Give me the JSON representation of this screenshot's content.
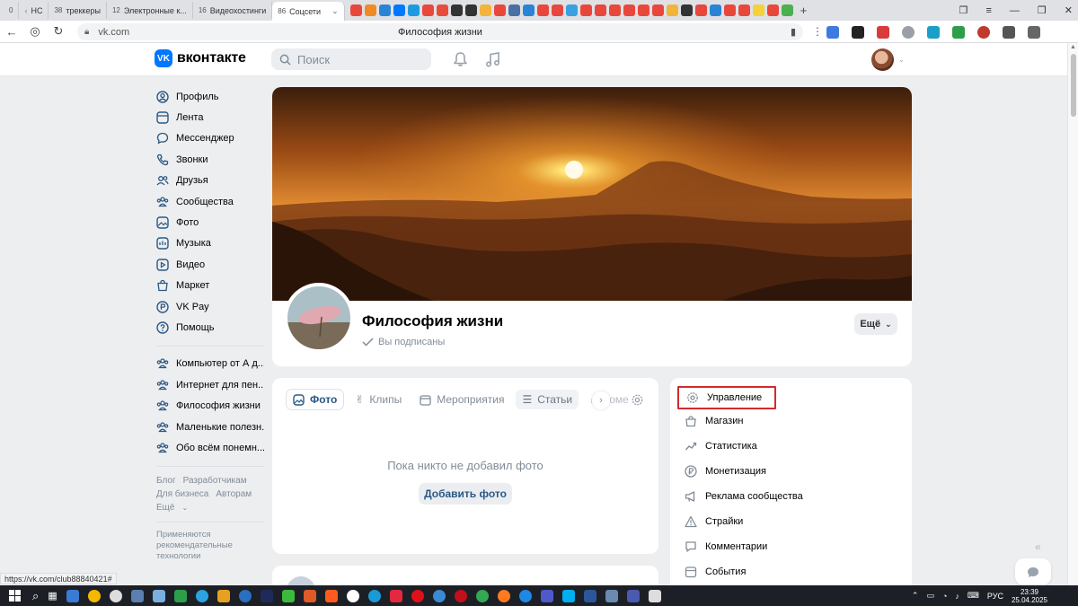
{
  "browser": {
    "tabs": [
      {
        "count": "0",
        "label": ""
      },
      {
        "count": "",
        "label": "НС"
      },
      {
        "count": "38",
        "label": "треккеры"
      },
      {
        "count": "12",
        "label": "Электронные к..."
      },
      {
        "count": "16",
        "label": "Видеохостинги"
      },
      {
        "count": "86",
        "label": "Соцсети"
      }
    ],
    "url": "vk.com",
    "page_title": "Философия жизни",
    "status_link": "https://vk.com/club88840421#"
  },
  "header": {
    "logo": "вконтакте",
    "search_placeholder": "Поиск"
  },
  "leftnav": {
    "main": [
      {
        "label": "Профиль",
        "icon": "user-icon"
      },
      {
        "label": "Лента",
        "icon": "feed-icon"
      },
      {
        "label": "Мессенджер",
        "icon": "message-icon"
      },
      {
        "label": "Звонки",
        "icon": "phone-icon"
      },
      {
        "label": "Друзья",
        "icon": "friends-icon"
      },
      {
        "label": "Сообщества",
        "icon": "groups-icon"
      },
      {
        "label": "Фото",
        "icon": "photo-icon"
      },
      {
        "label": "Музыка",
        "icon": "music-icon"
      },
      {
        "label": "Видео",
        "icon": "video-icon"
      },
      {
        "label": "Маркет",
        "icon": "market-icon"
      },
      {
        "label": "VK Pay",
        "icon": "vkpay-icon"
      },
      {
        "label": "Помощь",
        "icon": "help-icon"
      }
    ],
    "groups": [
      {
        "label": "Компьютер от А д..."
      },
      {
        "label": "Интернет для пен..."
      },
      {
        "label": "Философия жизни"
      },
      {
        "label": "Маленькие полезн..."
      },
      {
        "label": "Обо всём понемн..."
      }
    ],
    "footer": {
      "blog": "Блог",
      "developers": "Разработчикам",
      "business": "Для бизнеса",
      "authors": "Авторам",
      "more": "Ещё"
    },
    "rec_note": "Применяются рекомендательные технологии"
  },
  "group": {
    "name": "Философия жизни",
    "subscribed": "Вы подписаны",
    "more_button": "Ещё"
  },
  "photos": {
    "tabs": [
      "Фото",
      "Клипы",
      "Мероприятия",
      "Статьи",
      "Хоме"
    ],
    "empty_text": "Пока никто не добавил фото",
    "add_button": "Добавить фото"
  },
  "management": {
    "items": [
      {
        "label": "Управление",
        "icon": "gear-icon"
      },
      {
        "label": "Магазин",
        "icon": "shop-icon"
      },
      {
        "label": "Статистика",
        "icon": "stats-icon"
      },
      {
        "label": "Монетизация",
        "icon": "ruble-icon"
      },
      {
        "label": "Реклама сообщества",
        "icon": "megaphone-icon"
      },
      {
        "label": "Страйки",
        "icon": "warning-icon"
      },
      {
        "label": "Комментарии",
        "icon": "comment-icon"
      },
      {
        "label": "События",
        "icon": "events-icon"
      }
    ]
  },
  "taskbar": {
    "lang": "РУС",
    "time": "23:39",
    "date": "25.04.2025"
  },
  "colors": {
    "accent": "#0077ff",
    "link": "#2a5885",
    "highlight": "#d42a2a",
    "page_bg": "#edeef0"
  }
}
